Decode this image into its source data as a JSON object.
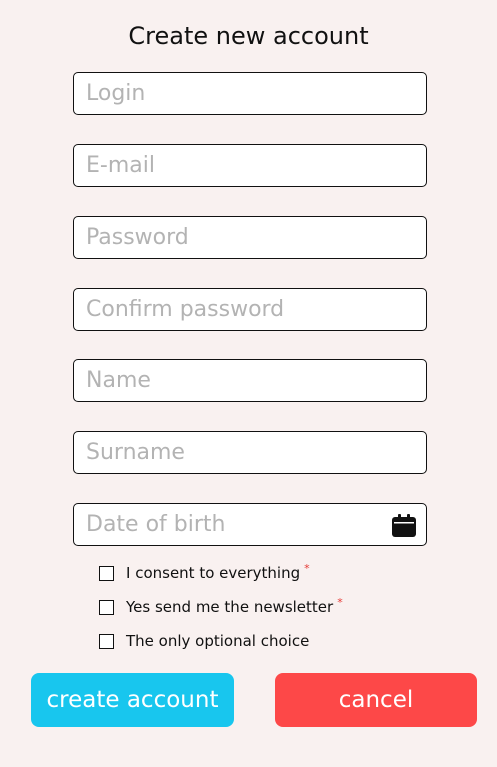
{
  "title": "Create new account",
  "fields": [
    {
      "placeholder": "Login",
      "value": ""
    },
    {
      "placeholder": "E-mail",
      "value": ""
    },
    {
      "placeholder": "Password",
      "value": ""
    },
    {
      "placeholder": "Confirm password",
      "value": ""
    },
    {
      "placeholder": "Name",
      "value": ""
    },
    {
      "placeholder": "Surname",
      "value": ""
    },
    {
      "placeholder": "Date of birth",
      "value": ""
    }
  ],
  "date_icon": "calendar-icon",
  "checkboxes": [
    {
      "label": "I consent to everything",
      "required_mark": "*",
      "checked": false
    },
    {
      "label": "Yes send me the newsletter",
      "required_mark": "*",
      "checked": false
    },
    {
      "label": "The only optional choice",
      "checked": false
    }
  ],
  "buttons": {
    "create": {
      "label": "create account",
      "color": "#18c6ee"
    },
    "cancel": {
      "label": "cancel",
      "color": "#fd4848"
    }
  },
  "colors": {
    "background": "#f9f1f0",
    "required": "#e53935"
  }
}
